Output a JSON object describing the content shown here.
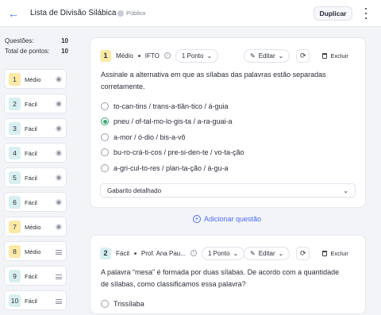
{
  "header": {
    "title": "Lista de Divisão Silábica",
    "visibility": "Público",
    "duplicate_label": "Duplicar"
  },
  "sidebar": {
    "questions_label": "Questões:",
    "questions_value": "10",
    "points_label": "Total de pontos:",
    "points_value": "10",
    "items": [
      {
        "num": "1",
        "level": "Médio",
        "icon": "radio-icon"
      },
      {
        "num": "2",
        "level": "Fácil",
        "icon": "radio-icon"
      },
      {
        "num": "3",
        "level": "Fácil",
        "icon": "radio-icon"
      },
      {
        "num": "4",
        "level": "Fácil",
        "icon": "radio-icon"
      },
      {
        "num": "5",
        "level": "Fácil",
        "icon": "radio-icon"
      },
      {
        "num": "6",
        "level": "Fácil",
        "icon": "radio-icon"
      },
      {
        "num": "7",
        "level": "Médio",
        "icon": "radio-icon"
      },
      {
        "num": "8",
        "level": "Médio",
        "icon": "lines-icon"
      },
      {
        "num": "9",
        "level": "Fácil",
        "icon": "lines-icon"
      },
      {
        "num": "10",
        "level": "Fácil",
        "icon": "lines-icon"
      }
    ]
  },
  "q1": {
    "num": "1",
    "level": "Médio",
    "source": "IFTO",
    "points": "1 Ponto",
    "edit": "Editar",
    "delete": "Excluir",
    "text": "Assinale a alternativa em que as sílabas das palavras estão separadas corretamente.",
    "options": [
      "to-can-tins / trans-a-tlân-tico / á-guia",
      "pneu / of-tal-mo-lo-gis-ta / a-ra-guai-a",
      "a-mor / ó-dio / bis-a-vô",
      "bu-ro-crá-ti-cos / pre-si-den-te / vo-ta-ção",
      "a-gri-cul-to-res / plan-ta-ção / á-gu-a"
    ],
    "selected": 1,
    "answer_label": "Gabarito detalhado"
  },
  "add_question": "Adicionar questão",
  "q2": {
    "num": "2",
    "level": "Fácil",
    "source": "Prof. Ana Pau...",
    "points": "1 Ponto",
    "edit": "Editar",
    "delete": "Excluir",
    "text": "A palavra “mesa” é formada por duas sílabas. De acordo com a quantidade de sílabas, como classificamos essa palavra?",
    "first_option": "Trissílaba"
  },
  "colors": {
    "accent": "#4a6cf7",
    "medium": "#fbe9a6",
    "easy": "#d7eff0",
    "correct": "#3aa876"
  }
}
